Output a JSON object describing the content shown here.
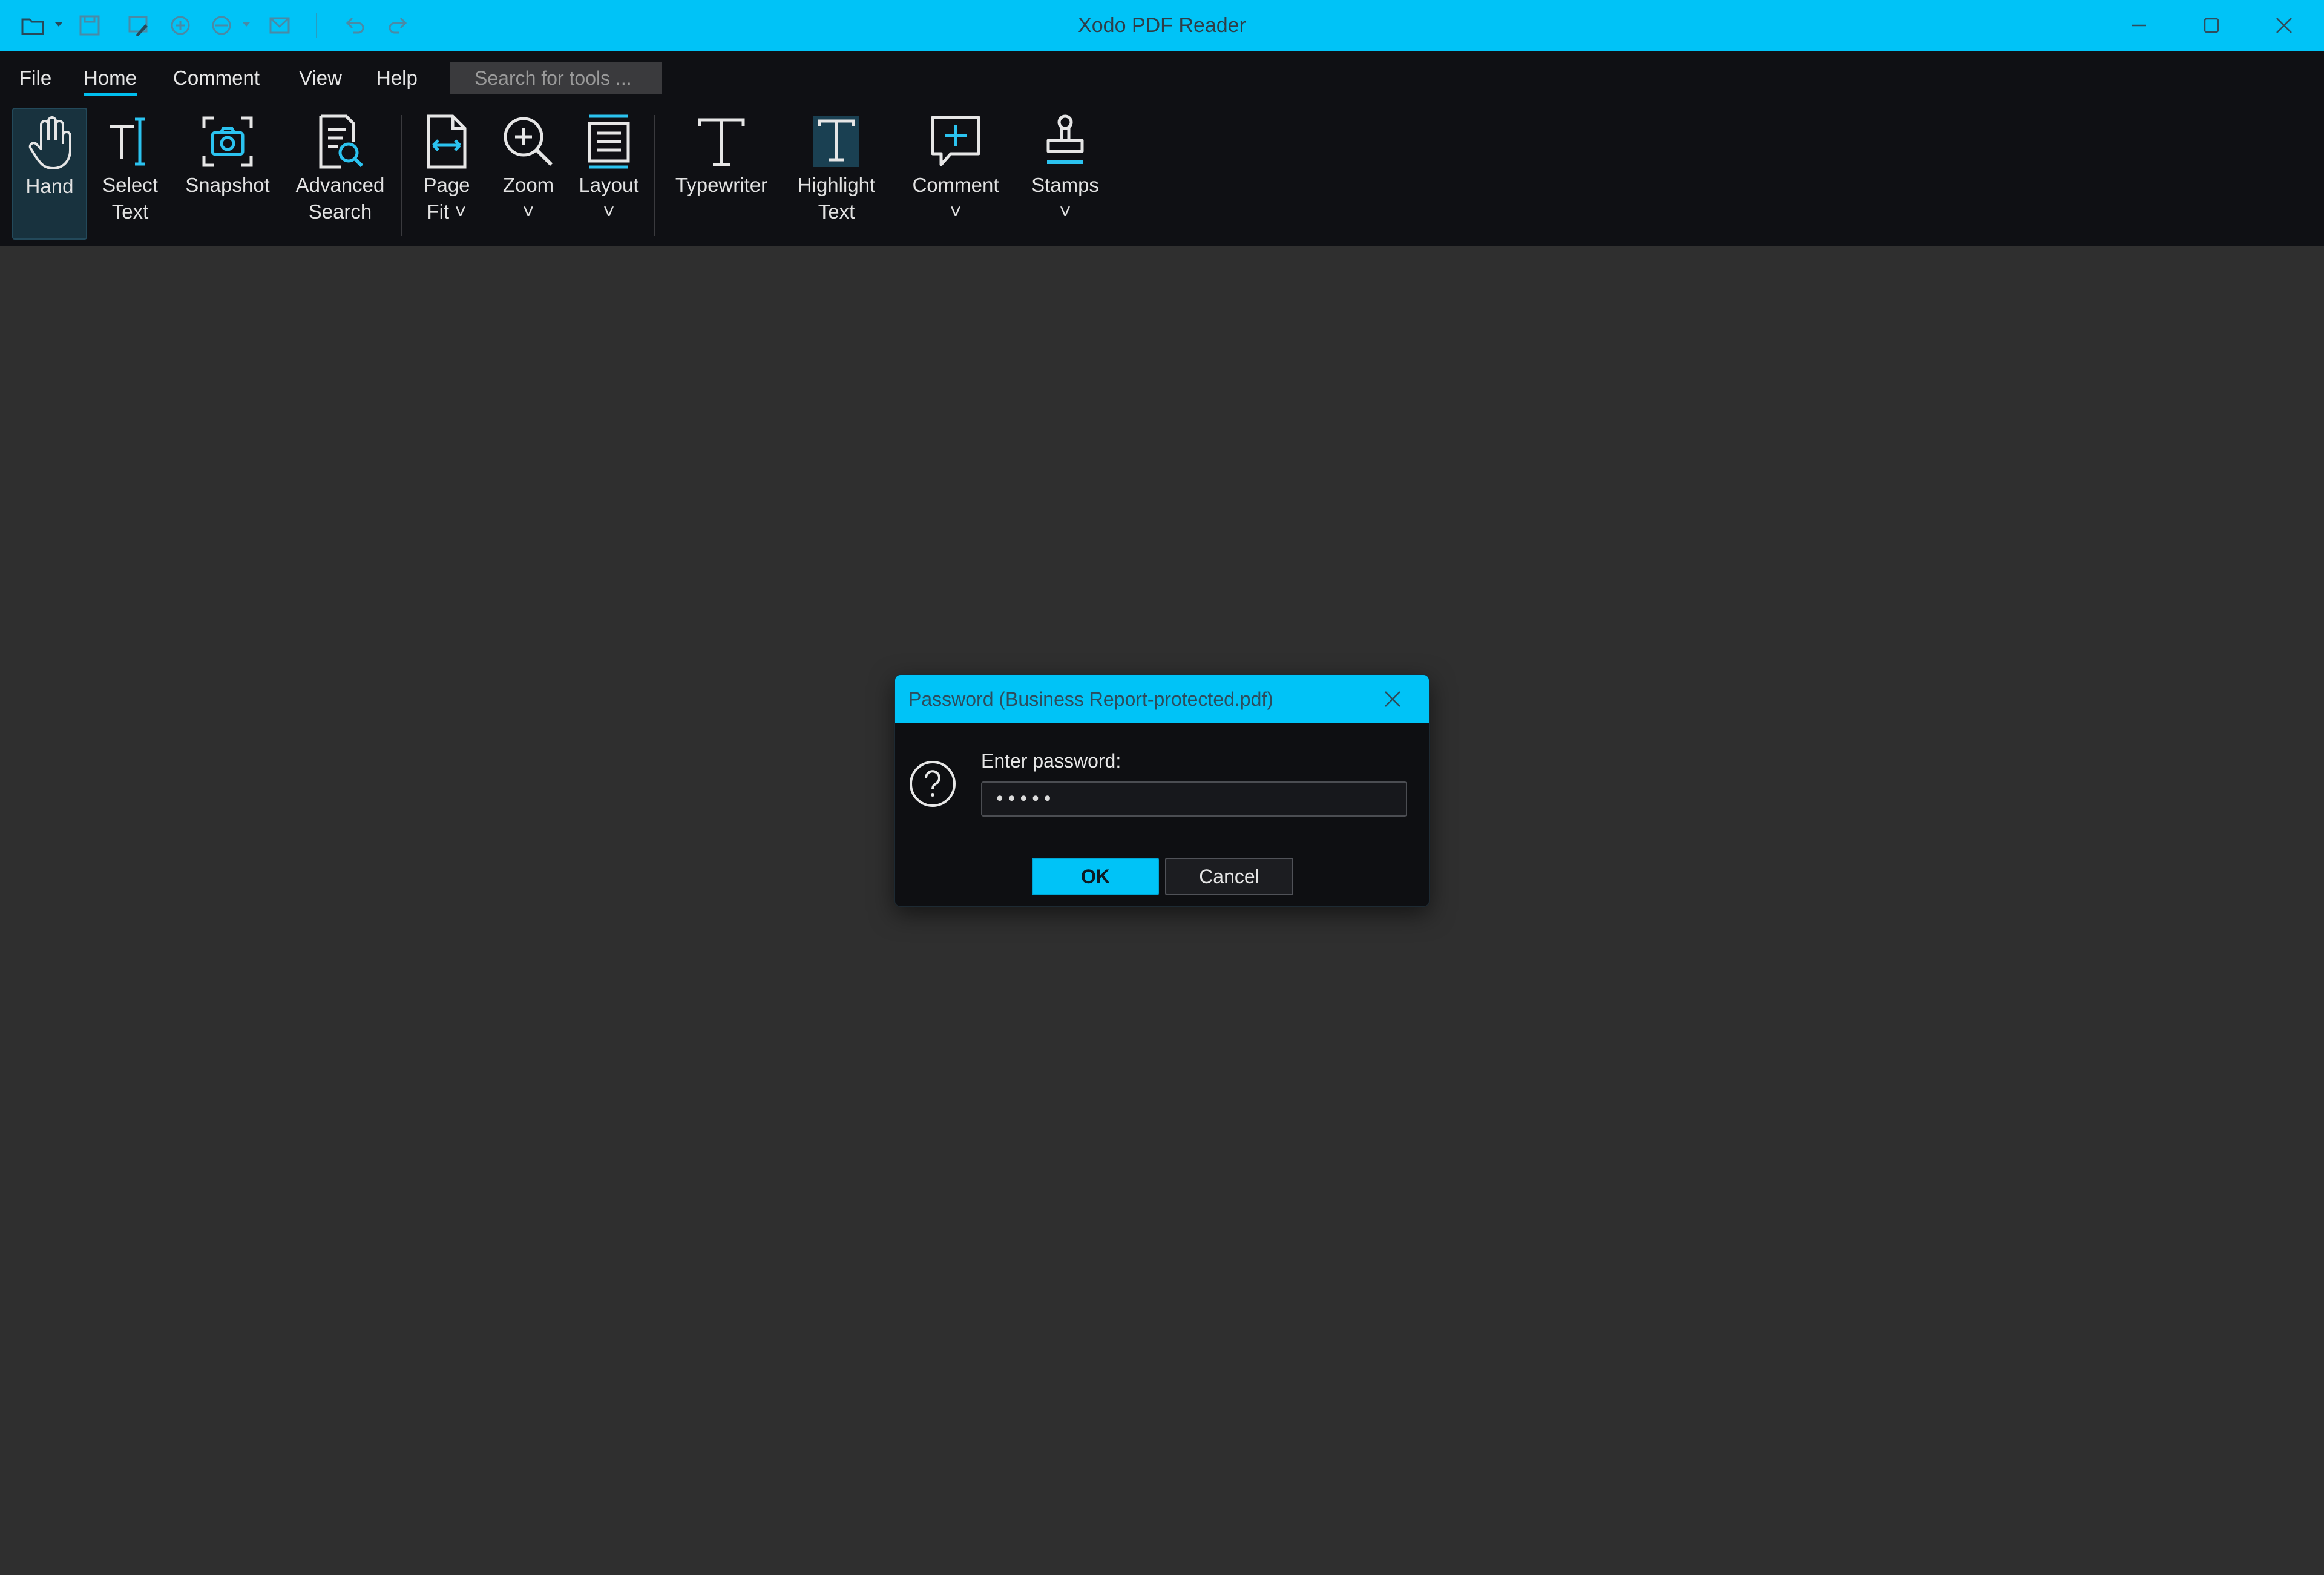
{
  "window": {
    "title": "Xodo PDF Reader"
  },
  "colors": {
    "accent": "#00c3f7",
    "ribbon_bg": "#0f1014",
    "workspace_bg": "#2f2f2f",
    "icon_blue": "#2bc3f0"
  },
  "quick_access": [
    {
      "icon": "folder-open-icon"
    },
    {
      "icon": "save-icon"
    },
    {
      "icon": "sign-icon"
    },
    {
      "icon": "print-icon"
    },
    {
      "icon": "share-icon"
    },
    {
      "icon": "email-icon"
    },
    {
      "icon": "undo-icon"
    },
    {
      "icon": "redo-icon"
    }
  ],
  "menu": {
    "items": [
      "File",
      "Home",
      "Comment",
      "View",
      "Help"
    ],
    "active": "Home",
    "search_placeholder": "Search for tools ..."
  },
  "ribbon": {
    "hand": "Hand",
    "select_text": "Select\nText",
    "snapshot": "Snapshot",
    "advanced_search": "Advanced\nSearch",
    "page_fit": "Page\nFit",
    "zoom": "Zoom",
    "layout": "Layout",
    "typewriter": "Typewriter",
    "highlight_text": "Highlight\nText",
    "comment": "Comment",
    "stamps": "Stamps"
  },
  "dialog": {
    "title": "Password (Business Report-protected.pdf)",
    "label": "Enter password:",
    "password_value": "•••••",
    "ok_label": "OK",
    "cancel_label": "Cancel"
  }
}
